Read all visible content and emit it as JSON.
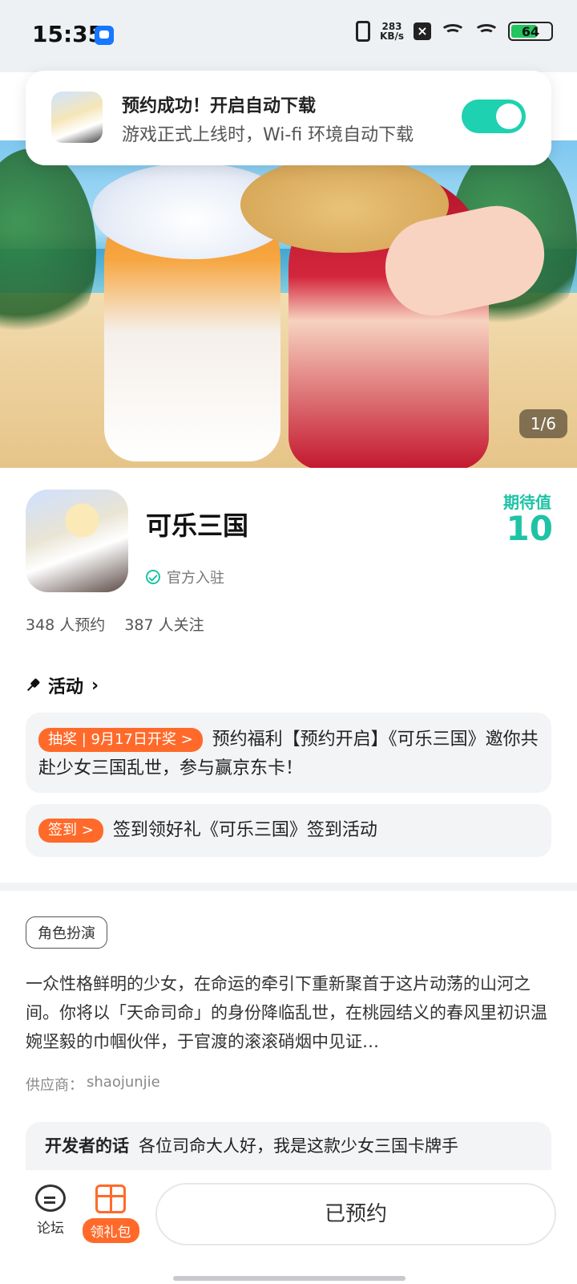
{
  "status_bar": {
    "time": "15:35",
    "net_speed_value": "283",
    "net_speed_unit": "KB/s",
    "battery": "64"
  },
  "toast": {
    "title": "预约成功！开启自动下载",
    "subtitle": "游戏正式上线时，Wi-fi 环境自动下载",
    "toggle_on": true
  },
  "banner": {
    "counter": "1/6"
  },
  "game": {
    "title": "可乐三国",
    "verified_label": "官方入驻",
    "expect_label": "期待值",
    "expect_value": "10",
    "reservations": "348 人预约",
    "followers": "387 人关注"
  },
  "activities": {
    "title": "活动",
    "items": [
      {
        "tag": "抽奖 | 9月17日开奖 >",
        "text": "预约福利【预约开启】《可乐三国》邀你共赴少女三国乱世，参与赢京东卡！"
      },
      {
        "tag": "签到 >",
        "text": "签到领好礼《可乐三国》签到活动"
      }
    ]
  },
  "details": {
    "genre": "角色扮演",
    "description": "一众性格鲜明的少女，在命运的牵引下重新聚首于这片动荡的山河之间。你将以「天命司命」的身份降临乱世，在桃园结义的春风里初识温婉坚毅的巾帼伙伴，于官渡的滚滚硝烟中见证…",
    "supplier_label": "供应商：",
    "supplier": "shaojunjie"
  },
  "developer_note": {
    "label": "开发者的话",
    "text": "各位司命大人好，我是这款少女三国卡牌手"
  },
  "bottom_bar": {
    "forum_label": "论坛",
    "gift_label": "领礼包",
    "reserve_button": "已预约"
  },
  "colors": {
    "accent": "#1ec3a6",
    "orange": "#ff6a2a"
  }
}
